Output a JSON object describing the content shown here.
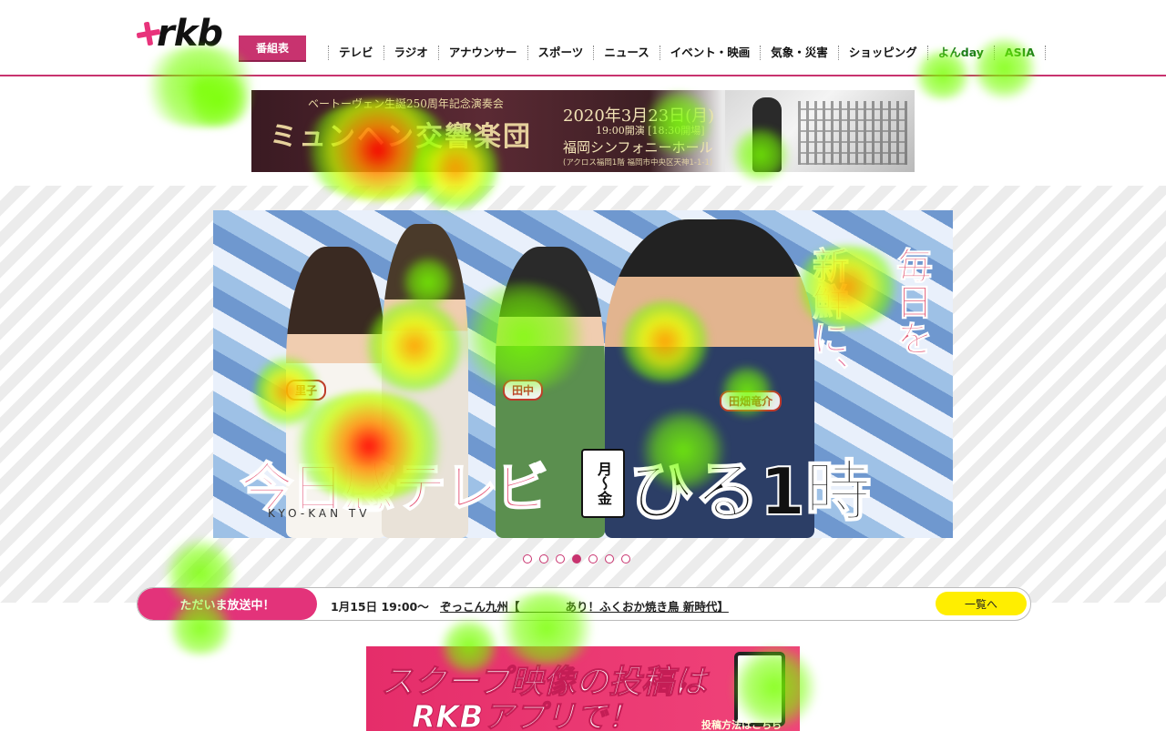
{
  "header": {
    "logo_text": "rkb",
    "bangumi_label": "番組表",
    "nav": [
      "テレビ",
      "ラジオ",
      "アナウンサー",
      "スポーツ",
      "ニュース",
      "イベント・映画",
      "気象・災害",
      "ショッピング",
      "よんday",
      "ASIA"
    ]
  },
  "top_banner": {
    "subtitle": "ベートーヴェン生誕250周年記念演奏会",
    "title": "ミュンヘン交響楽団",
    "date": "2020年3月23日(月)",
    "time": "19:00開演 [18:30開場]",
    "hall": "福岡シンフォニーホール",
    "address": "(アクロス福岡1階 福岡市中央区天神1-1-1)"
  },
  "hero": {
    "catch_a": "毎日を",
    "catch_b": "新鮮に、",
    "name_1": "里子",
    "name_2": "田中",
    "name_3": "田畑竜介",
    "logo": "今日感テレビ",
    "logo_sub": "KYO-KAN TV",
    "days": "月〜金",
    "time": "ひる1時55分"
  },
  "slider": {
    "count": 7,
    "active_index": 3
  },
  "onair": {
    "label": "ただいま放送中！",
    "time": "1月15日 19:00〜",
    "title": "ぞっこん九州【　　　　あり！ふくおか焼き鳥 新時代】",
    "list_button": "一覧へ"
  },
  "bottom_banner": {
    "line1": "スクープ映像の投稿は",
    "line2": "RKBアプリで！",
    "link": "投稿方法はこちら"
  },
  "colors": {
    "brand_pink": "#c8336f",
    "onair_pink": "#e3337a",
    "yellow": "#ffee00"
  }
}
